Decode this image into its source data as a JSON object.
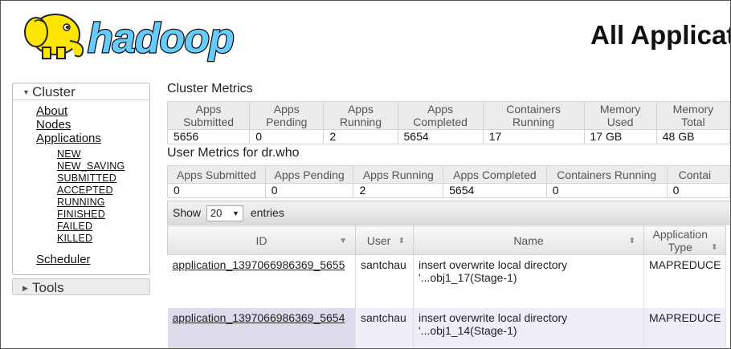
{
  "header": {
    "logo_text": "hadoop",
    "page_title": "All Applications"
  },
  "sidebar": {
    "cluster_label": "Cluster",
    "links": [
      "About",
      "Nodes",
      "Applications"
    ],
    "app_states": [
      "NEW",
      "NEW_SAVING",
      "SUBMITTED",
      "ACCEPTED",
      "RUNNING",
      "FINISHED",
      "FAILED",
      "KILLED"
    ],
    "scheduler": "Scheduler",
    "tools_label": "Tools"
  },
  "cluster_metrics": {
    "title": "Cluster Metrics",
    "headers": [
      "Apps\nSubmitted",
      "Apps\nPending",
      "Apps\nRunning",
      "Apps\nCompleted",
      "Containers\nRunning",
      "Memory\nUsed",
      "Memory\nTotal"
    ],
    "values": [
      "5656",
      "0",
      "2",
      "5654",
      "17",
      "17 GB",
      "48 GB"
    ]
  },
  "user_metrics": {
    "title": "User Metrics for dr.who",
    "headers": [
      "Apps Submitted",
      "Apps Pending",
      "Apps Running",
      "Apps Completed",
      "Containers Running",
      "Contai"
    ],
    "values": [
      "0",
      "0",
      "2",
      "5654",
      "0",
      "0"
    ]
  },
  "table_controls": {
    "show": "Show",
    "page_size": "20",
    "entries": "entries"
  },
  "apps_table": {
    "columns": [
      "ID",
      "User",
      "Name",
      "Application\nType"
    ],
    "rows": [
      {
        "id": "application_1397066986369_5655",
        "user": "santchau",
        "name": "insert overwrite local directory\n'...obj1_17(Stage-1)",
        "type": "MAPREDUCE"
      },
      {
        "id": "application_1397066986369_5654",
        "user": "santchau",
        "name": "insert overwrite local directory\n'...obj1_14(Stage-1)",
        "type": "MAPREDUCE"
      }
    ]
  },
  "colors": {
    "logo_fill": "#66ccff",
    "elephant": "#ffe600",
    "row_alt": "#eeeef9",
    "header_bg": "#ececec"
  }
}
